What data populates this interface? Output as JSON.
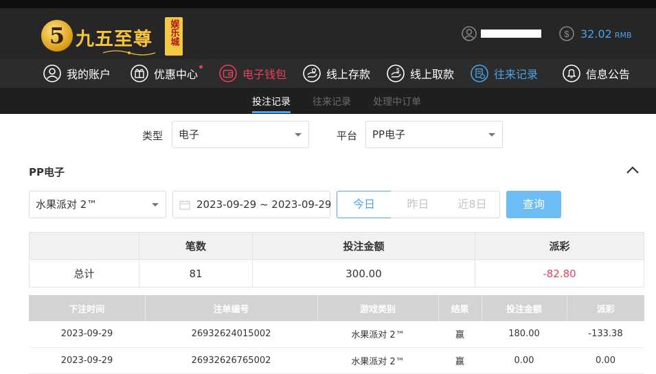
{
  "brand": {
    "badge": "5",
    "name": "九五至尊",
    "stamp": "娱乐城"
  },
  "account": {
    "balance": "32.02",
    "currency": "RMB"
  },
  "nav": [
    {
      "label": "我的账户",
      "icon": "user-icon"
    },
    {
      "label": "优惠中心",
      "icon": "gift-icon"
    },
    {
      "label": "电子钱包",
      "icon": "wallet-icon"
    },
    {
      "label": "线上存款",
      "icon": "deposit-icon"
    },
    {
      "label": "线上取款",
      "icon": "withdraw-icon"
    },
    {
      "label": "往来记录",
      "icon": "records-icon"
    },
    {
      "label": "信息公告",
      "icon": "bell-icon"
    }
  ],
  "subtabs": [
    "投注记录",
    "往来记录",
    "处理中订单"
  ],
  "filters": {
    "type_label": "类型",
    "type_value": "电子",
    "platform_label": "平台",
    "platform_value": "PP电子"
  },
  "section_title": "PP电子",
  "query": {
    "game": "水果派对 2™",
    "date_range": "2023-09-29 ~ 2023-09-29",
    "quick_today": "今日",
    "quick_yesterday": "昨日",
    "quick_8days": "近8日",
    "search_label": "查询"
  },
  "summary": {
    "headers": [
      "",
      "笔数",
      "投注金额",
      "派彩"
    ],
    "total_label": "总计",
    "count": "81",
    "bet_amount": "300.00",
    "payout": "-82.80"
  },
  "records": {
    "headers": [
      "下注时间",
      "注单编号",
      "游戏类别",
      "结果",
      "投注金额",
      "派彩"
    ],
    "rows": [
      {
        "time": "2023-09-29",
        "id": "26932624015002",
        "game": "水果派对 2™",
        "result": "赢",
        "bet": "180.00",
        "payout": "-133.38"
      },
      {
        "time": "2023-09-29",
        "id": "26932626765002",
        "game": "水果派对 2™",
        "result": "赢",
        "bet": "0.00",
        "payout": "0.00"
      }
    ]
  },
  "colors": {
    "accent": "#4aa3ef",
    "active_red": "#e9405a",
    "header_bg": "#262626",
    "gold": "#f5c33b"
  }
}
